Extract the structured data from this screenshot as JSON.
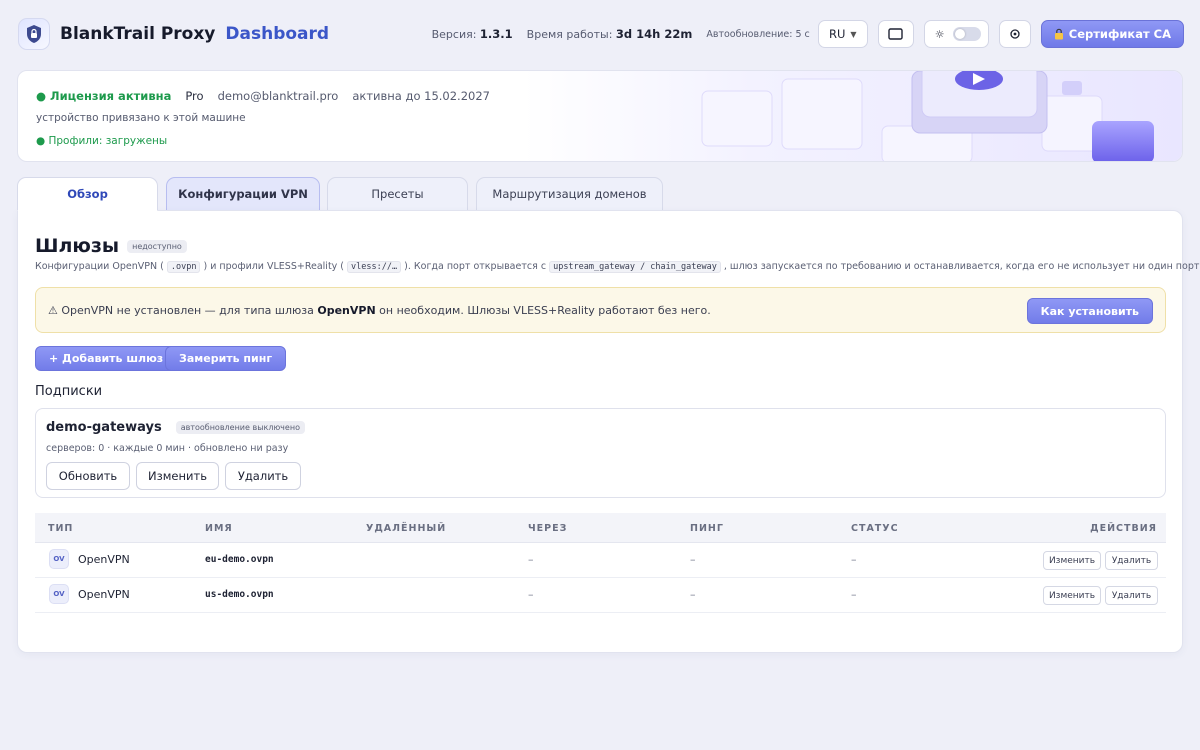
{
  "header": {
    "brand": "BlankTrail Proxy",
    "brand_sub": "Dashboard",
    "version_label": "Версия:",
    "version_value": "1.3.1",
    "uptime_label": "Время работы:",
    "uptime_value": "3d 14h 22m",
    "autorefresh": "Автообновление: 5 с",
    "language": "RU",
    "ca_button": "Сертификат CA",
    "accent": "#7b84ee"
  },
  "license": {
    "status": "Лицензия активна",
    "plan": "Pro",
    "email": "demo@blanktrail.pro",
    "valid_until": "активна до 15.02.2027",
    "binding": "устройство привязано к этой машине",
    "profiles": "Профили: загружены"
  },
  "tabs": [
    {
      "label": "Обзор"
    },
    {
      "label": "Конфигурации VPN"
    },
    {
      "label": "Пресеты"
    },
    {
      "label": "Маршрутизация доменов"
    }
  ],
  "gateways": {
    "title": "Шлюзы",
    "badge": "недоступно",
    "desc_1": "Конфигурации OpenVPN (",
    "desc_code_1": ".ovpn",
    "desc_2": ") и профили VLESS+Reality (",
    "desc_code_2": "vless://…",
    "desc_3": "). Когда порт открывается с",
    "desc_code_3": "upstream_gateway / chain_gateway",
    "desc_4": ", шлюз запускается по требованию и останавливается, когда его не использует ни один порт.",
    "warning_1": "⚠ OpenVPN не установлен — для типа шлюза",
    "warning_bold": "OpenVPN",
    "warning_2": "он необходим. Шлюзы VLESS+Reality работают без него.",
    "warning_button": "Как установить",
    "add_button": "+ Добавить шлюз",
    "ping_button": "Замерить пинг"
  },
  "subscriptions": {
    "title": "Подписки",
    "items": [
      {
        "name": "demo-gateways",
        "badge": "автообновление выключено",
        "meta": "серверов: 0 · каждые 0 мин · обновлено ни разу",
        "btn_refresh": "Обновить",
        "btn_edit": "Изменить",
        "btn_delete": "Удалить"
      }
    ]
  },
  "table": {
    "columns": [
      "ТИП",
      "ИМЯ",
      "УДАЛЁННЫЙ",
      "ЧЕРЕЗ",
      "ПИНГ",
      "СТАТУС",
      "ДЕЙСТВИЯ"
    ],
    "rows": [
      {
        "badge": "OV",
        "type": "OpenVPN",
        "name": "eu-demo.ovpn",
        "remote": "",
        "via": "–",
        "ping": "–",
        "status": "–",
        "edit": "Изменить",
        "delete": "Удалить"
      },
      {
        "badge": "OV",
        "type": "OpenVPN",
        "name": "us-demo.ovpn",
        "remote": "",
        "via": "–",
        "ping": "–",
        "status": "–",
        "edit": "Изменить",
        "delete": "Удалить"
      }
    ]
  }
}
